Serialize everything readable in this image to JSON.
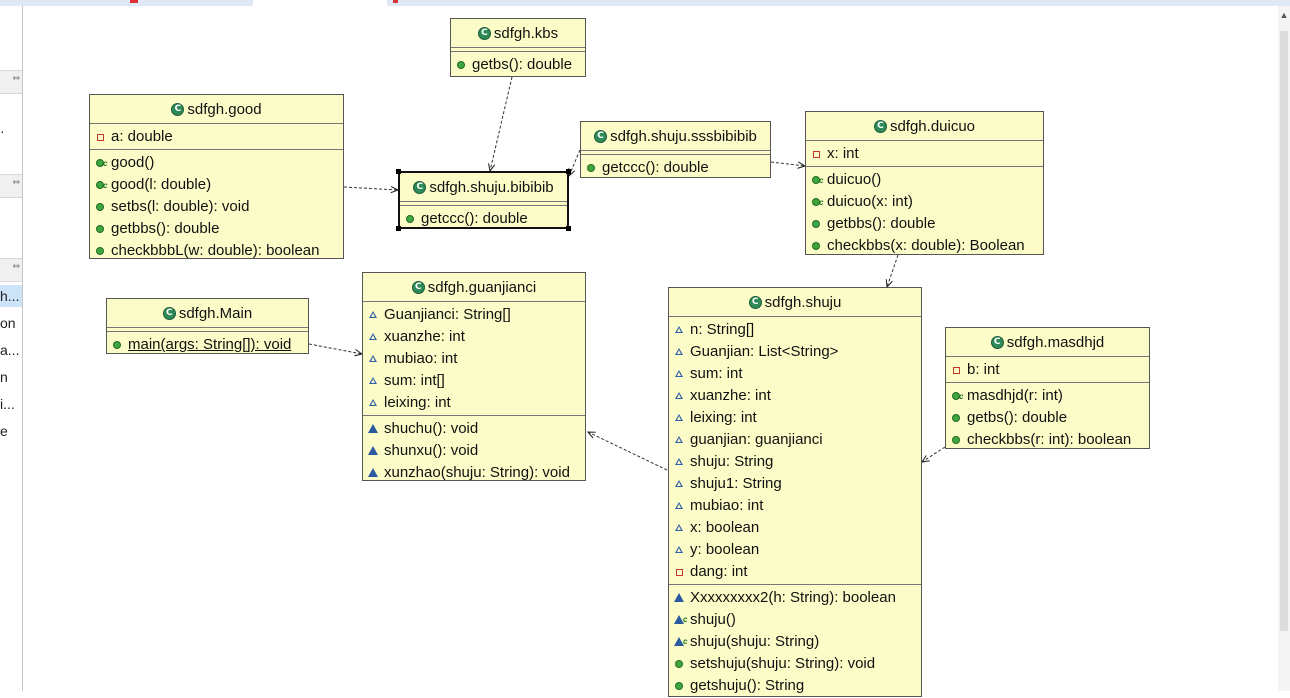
{
  "classes": {
    "kbs": {
      "name": "sdfgh.kbs",
      "methods": [
        "getbs(): double"
      ]
    },
    "good": {
      "name": "sdfgh.good",
      "attrs": [
        "a: double"
      ],
      "methods": [
        "good()",
        "good(l: double)",
        "setbs(l: double): void",
        "getbbs(): double",
        "checkbbbL(w: double): boolean"
      ]
    },
    "bibibib": {
      "name": "sdfgh.shuju.bibibib",
      "methods": [
        "getccc(): double"
      ]
    },
    "sssbibibib": {
      "name": "sdfgh.shuju.sssbibibib",
      "methods": [
        "getccc(): double"
      ]
    },
    "duicuo": {
      "name": "sdfgh.duicuo",
      "attrs": [
        "x: int"
      ],
      "methods": [
        "duicuo()",
        "duicuo(x: int)",
        "getbbs(): double",
        "checkbbs(x: double): Boolean"
      ]
    },
    "main": {
      "name": "sdfgh.Main",
      "methods": [
        "main(args: String[]): void"
      ]
    },
    "guanjianci": {
      "name": "sdfgh.guanjianci",
      "attrs": [
        "Guanjianci: String[]",
        "xuanzhe: int",
        "mubiao: int",
        "sum: int[]",
        "leixing: int"
      ],
      "methods": [
        "shuchu(): void",
        "shunxu(): void",
        "xunzhao(shuju: String): void"
      ]
    },
    "shuju": {
      "name": "sdfgh.shuju",
      "attrs": [
        "n: String[]",
        "Guanjian: List<String>",
        "sum: int",
        "xuanzhe: int",
        "leixing: int",
        "guanjian: guanjianci",
        "shuju: String",
        "shuju1: String",
        "mubiao: int",
        "x: boolean",
        "y: boolean",
        "dang: int"
      ],
      "methods": [
        "Xxxxxxxxx2(h: String): boolean",
        "shuju()",
        "shuju(shuju: String)",
        "setshuju(shuju: String): void",
        "getshuju(): String"
      ]
    },
    "masdhjd": {
      "name": "sdfgh.masdhjd",
      "attrs": [
        "b: int"
      ],
      "methods": [
        "masdhjd(r: int)",
        "getbs(): double",
        "checkbbs(r: int): boolean"
      ]
    }
  },
  "left_panel": {
    "rows": [
      "h...",
      "on",
      "a...",
      "n",
      "i...",
      "e"
    ]
  },
  "colors": {
    "class_fill": "#fcfcc8",
    "public_icon": "#3ea63e",
    "private_icon": "#c0392b",
    "package_icon": "#2c5aa0",
    "class_icon": "#2e8b57"
  }
}
